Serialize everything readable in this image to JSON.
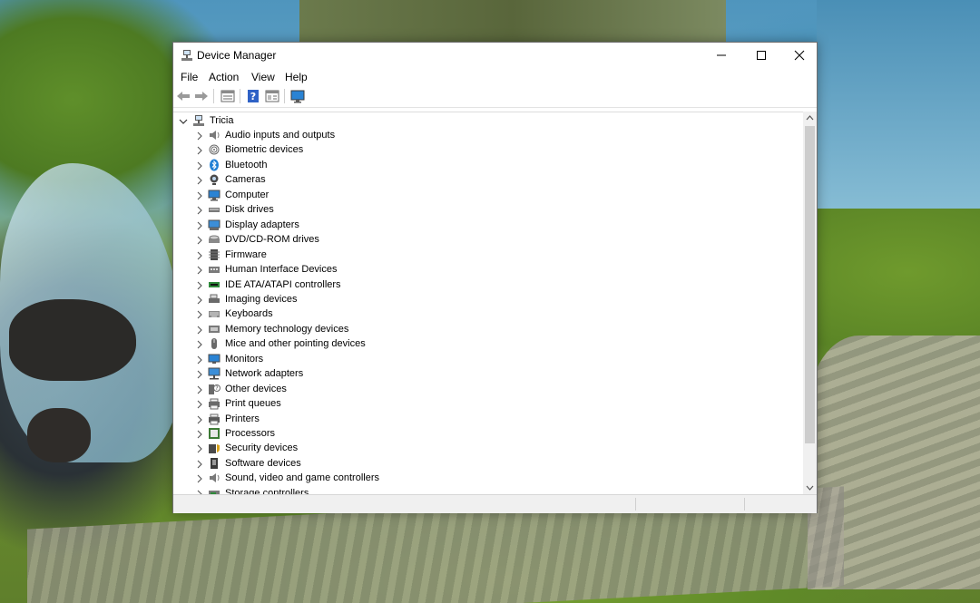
{
  "window": {
    "title": "Device Manager"
  },
  "menu": [
    "File",
    "Action",
    "View",
    "Help"
  ],
  "toolbar": {
    "buttons": [
      "back",
      "forward",
      "properties",
      "help",
      "show-hide",
      "scan-hardware"
    ]
  },
  "tree": {
    "root": "Tricia",
    "items": [
      {
        "label": "Audio inputs and outputs",
        "icon": "speaker-icon"
      },
      {
        "label": "Biometric devices",
        "icon": "fingerprint-icon"
      },
      {
        "label": "Bluetooth",
        "icon": "bluetooth-icon"
      },
      {
        "label": "Cameras",
        "icon": "camera-icon"
      },
      {
        "label": "Computer",
        "icon": "computer-icon"
      },
      {
        "label": "Disk drives",
        "icon": "disk-icon"
      },
      {
        "label": "Display adapters",
        "icon": "display-adapter-icon"
      },
      {
        "label": "DVD/CD-ROM drives",
        "icon": "dvd-icon"
      },
      {
        "label": "Firmware",
        "icon": "firmware-icon"
      },
      {
        "label": "Human Interface Devices",
        "icon": "hid-icon"
      },
      {
        "label": "IDE ATA/ATAPI controllers",
        "icon": "ide-icon"
      },
      {
        "label": "Imaging devices",
        "icon": "scanner-icon"
      },
      {
        "label": "Keyboards",
        "icon": "keyboard-icon"
      },
      {
        "label": "Memory technology devices",
        "icon": "memory-icon"
      },
      {
        "label": "Mice and other pointing devices",
        "icon": "mouse-icon"
      },
      {
        "label": "Monitors",
        "icon": "monitor-icon"
      },
      {
        "label": "Network adapters",
        "icon": "network-icon"
      },
      {
        "label": "Other devices",
        "icon": "unknown-device-icon"
      },
      {
        "label": "Print queues",
        "icon": "print-queue-icon"
      },
      {
        "label": "Printers",
        "icon": "printer-icon"
      },
      {
        "label": "Processors",
        "icon": "processor-icon"
      },
      {
        "label": "Security devices",
        "icon": "security-icon"
      },
      {
        "label": "Software devices",
        "icon": "software-device-icon"
      },
      {
        "label": "Sound, video and game controllers",
        "icon": "sound-icon"
      },
      {
        "label": "Storage controllers",
        "icon": "storage-icon"
      }
    ]
  },
  "colors": {
    "window_bg": "#ffffff",
    "accent_blue": "#1f7fd4",
    "statusbar_bg": "#f0f0f0"
  }
}
